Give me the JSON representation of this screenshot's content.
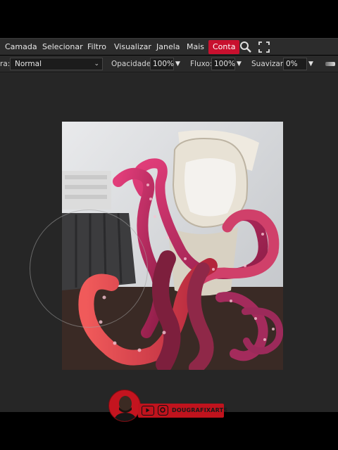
{
  "menu": {
    "items": [
      "Camada",
      "Selecionar",
      "Filtro",
      "Visualizar",
      "Janela",
      "Mais"
    ],
    "active": "Conta"
  },
  "options": {
    "blend_label_partial": "ra:",
    "blend_value": "Normal",
    "opacity_label": "Opacidade:",
    "opacity_value": "100%",
    "flow_label": "Fluxo:",
    "flow_value": "100%",
    "smooth_label": "Suavizar:",
    "smooth_value": "0%"
  },
  "watermark": {
    "handle": "DOUGRAFIXARTS"
  },
  "colors": {
    "accent": "#c8102e",
    "menubar": "#2c2c2c",
    "workspace": "#262626"
  }
}
